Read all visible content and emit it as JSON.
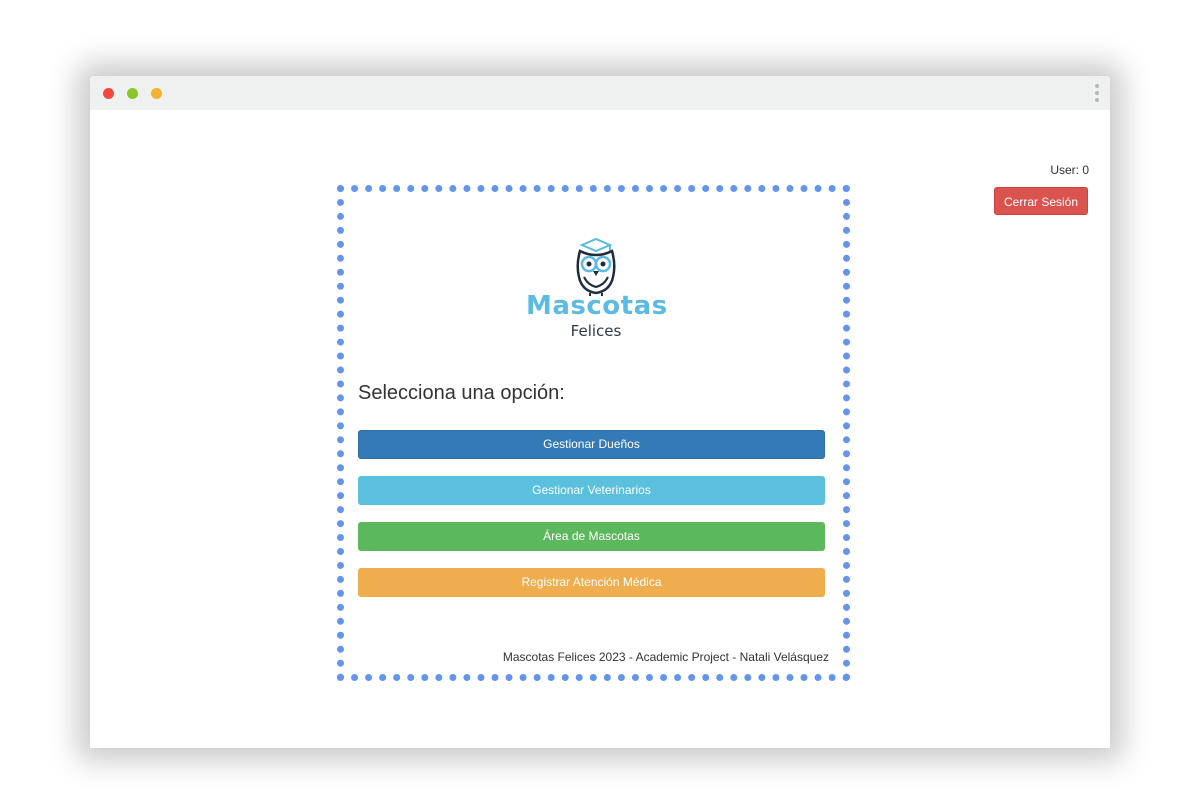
{
  "window": {
    "controls": [
      "close",
      "minimize",
      "maximize"
    ],
    "menu_icon": "kebab-menu-icon"
  },
  "header": {
    "user_label": "User: 0",
    "logout_label": "Cerrar Sesión"
  },
  "brand": {
    "name_main": "Mascotas",
    "name_sub": "Felices",
    "logo_icon": "owl-graduate-icon"
  },
  "menu": {
    "heading": "Selecciona una opción:",
    "buttons": [
      {
        "label": "Gestionar Dueños",
        "color": "#337ab7"
      },
      {
        "label": "Gestionar Veterinarios",
        "color": "#5bc0de"
      },
      {
        "label": "Área de Mascotas",
        "color": "#5cb85c"
      },
      {
        "label": "Registrar Atención Médica",
        "color": "#f0ad4e"
      }
    ]
  },
  "footer": {
    "text": "Mascotas Felices 2023 - Academic Project - Natali Velásquez"
  },
  "colors": {
    "panel_border": "#6495ed",
    "logout": "#d9534f",
    "brand_main": "#5bbbe0"
  }
}
